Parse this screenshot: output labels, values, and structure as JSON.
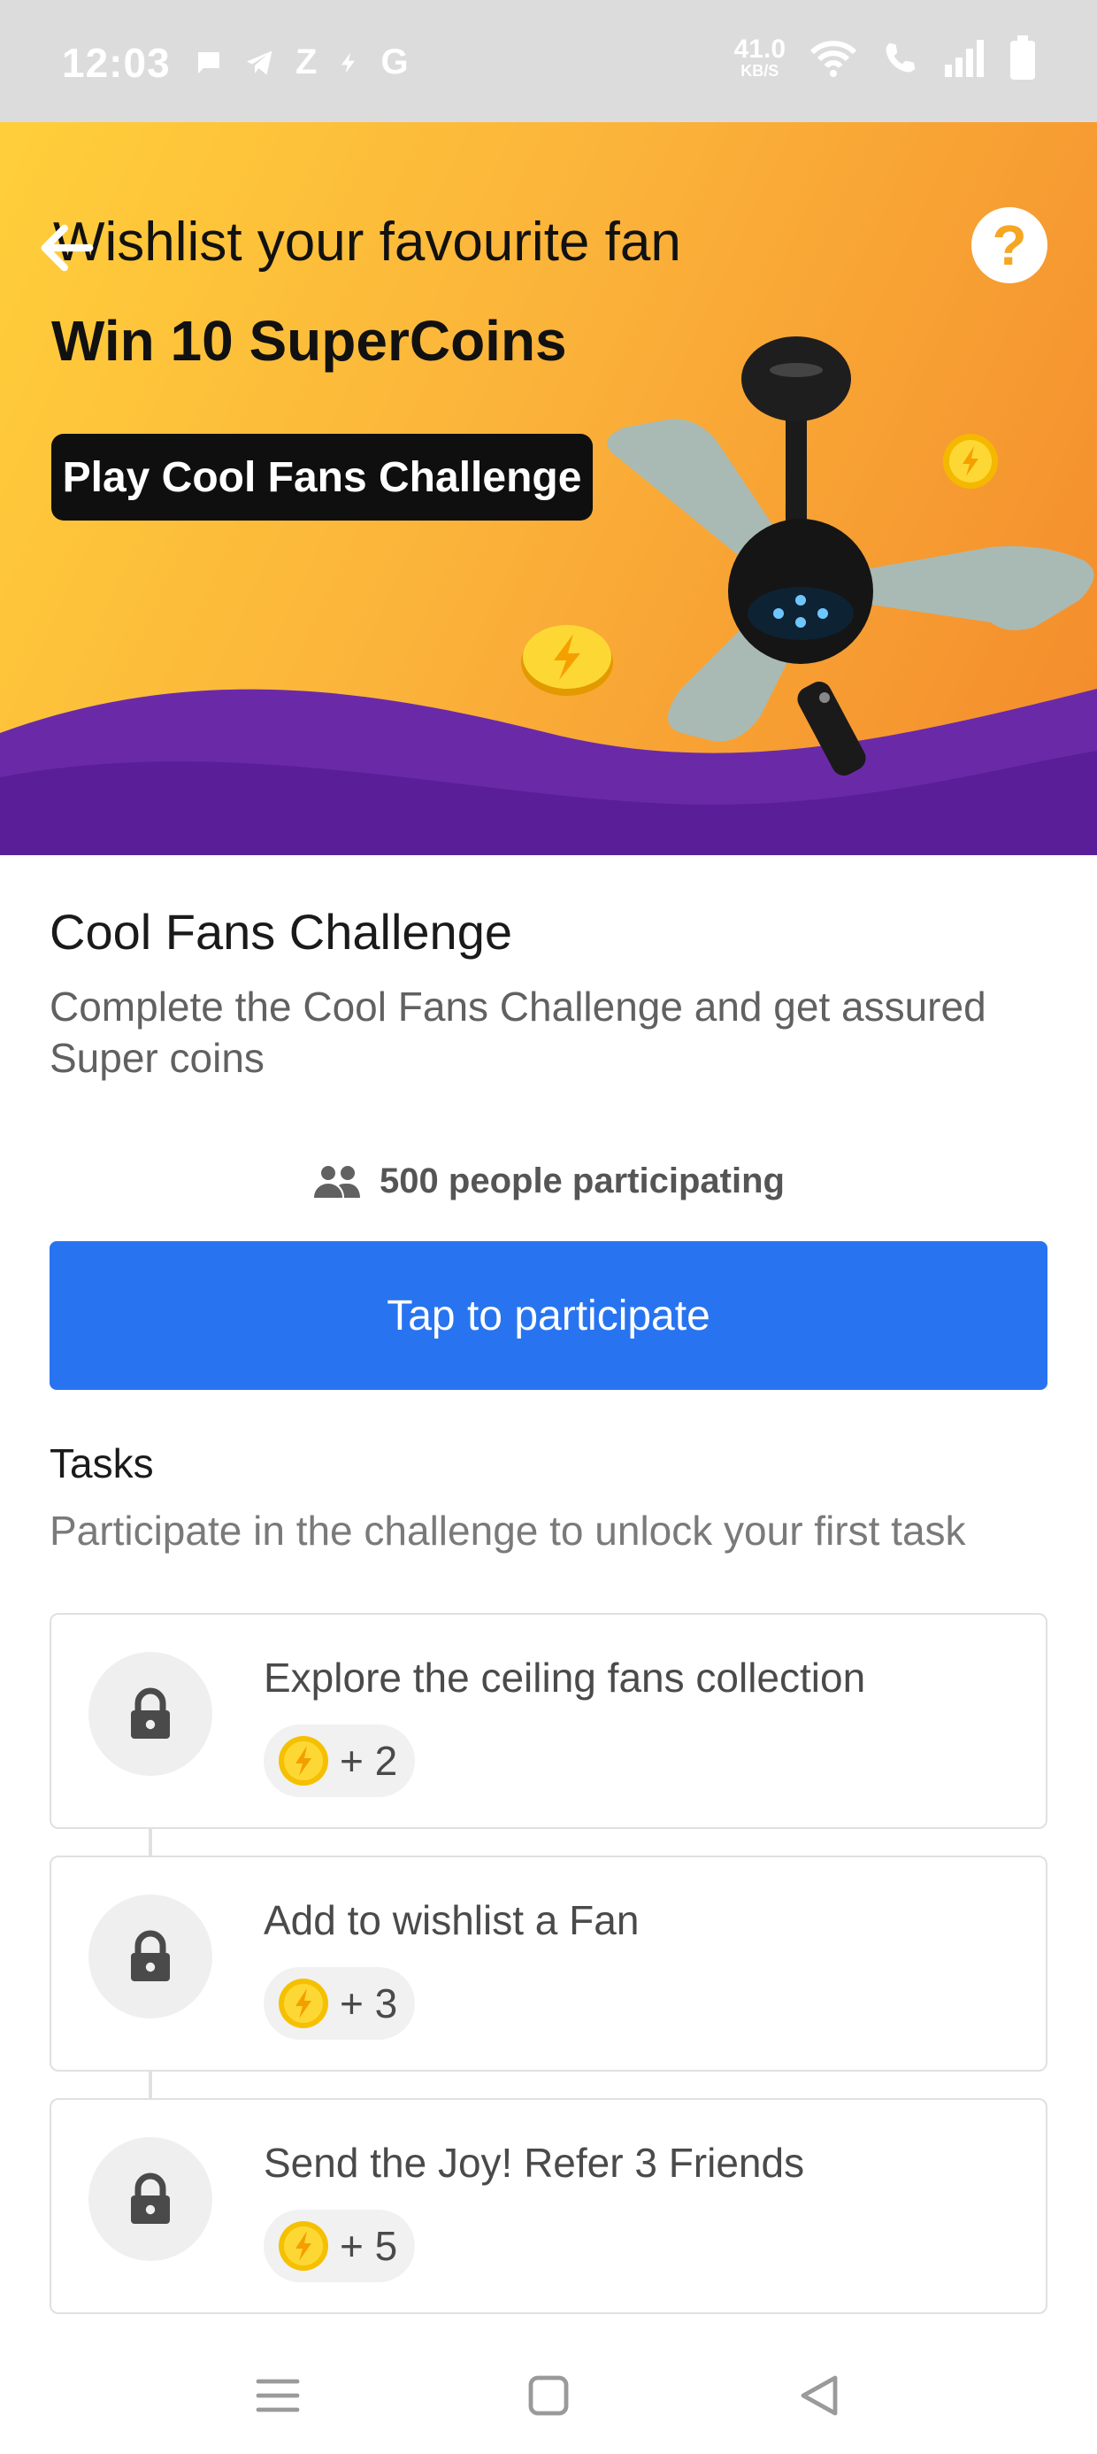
{
  "status_bar": {
    "time": "12:03",
    "apps": [
      "Z",
      "G"
    ],
    "net_speed_value": "41.0",
    "net_speed_unit": "KB/S"
  },
  "banner": {
    "headline": "Wishlist your favourite fan",
    "subheadline": "Win 10 SuperCoins",
    "cta": "Play Cool Fans Challenge",
    "help": "?"
  },
  "challenge": {
    "title": "Cool Fans Challenge",
    "description": "Complete the Cool Fans Challenge and get assured Super coins",
    "participants": "500 people participating",
    "participate_label": "Tap to participate"
  },
  "tasks": {
    "heading": "Tasks",
    "subheading": "Participate in the challenge to unlock your first task",
    "items": [
      {
        "title": "Explore the ceiling fans collection",
        "reward": "+ 2"
      },
      {
        "title": "Add to wishlist a Fan",
        "reward": "+ 3"
      },
      {
        "title": "Send the Joy! Refer 3 Friends",
        "reward": "+ 5"
      }
    ]
  },
  "colors": {
    "primary": "#2874f0",
    "banner_yellow": "#ffcf3a",
    "banner_orange": "#f38a2b",
    "banner_purple": "#6a2aa8",
    "coin": "#fdd835"
  },
  "icons": [
    "back-arrow-icon",
    "help-icon",
    "people-icon",
    "lock-icon",
    "supercoin-icon",
    "menu-icon",
    "home-icon",
    "back-triangle-icon"
  ]
}
